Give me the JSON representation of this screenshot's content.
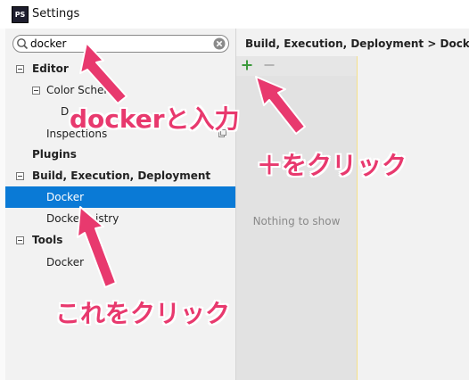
{
  "window": {
    "title": "Settings",
    "app_icon": "PS"
  },
  "search": {
    "value": "docker"
  },
  "tree": {
    "editor": "Editor",
    "color_scheme": "Color Scheme",
    "color_scheme_child": "D",
    "inspections": "Inspections",
    "plugins": "Plugins",
    "build": "Build, Execution, Deployment",
    "docker_selected": "Docker",
    "docker_registry_prefix": "Docker",
    "docker_registry_suffix": "istry",
    "tools": "Tools",
    "tools_docker": "Docker"
  },
  "right": {
    "breadcrumb": "Build, Execution, Deployment > Docker",
    "empty_text": "Nothing to show"
  },
  "annotations": {
    "type_docker": "dockerと入力",
    "click_plus": "＋をクリック",
    "click_this": "これをクリック"
  },
  "colors": {
    "selection": "#0a7ad6",
    "annotation": "#e8396e",
    "add_icon": "#3c9a3c"
  }
}
